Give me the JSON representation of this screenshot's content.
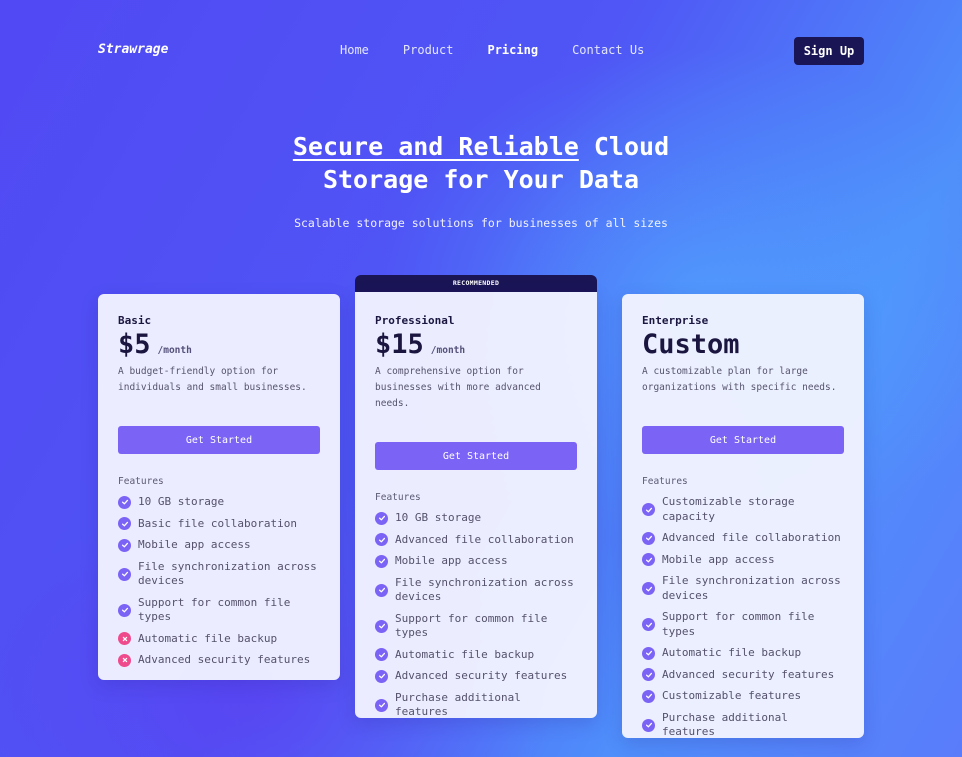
{
  "nav": {
    "brand": "Strawrage",
    "links": [
      "Home",
      "Product",
      "Pricing",
      "Contact Us"
    ],
    "active": "Pricing",
    "signup": "Sign Up"
  },
  "hero": {
    "title_highlight": "Secure and Reliable",
    "title_rest_1": " Cloud",
    "title_rest_2": "Storage for Your Data",
    "subtitle": "Scalable storage solutions for businesses of all sizes"
  },
  "badge": "RECOMMENDED",
  "colors": {
    "accent": "#7b63f6",
    "dark": "#1a1555",
    "no": "#ee4a8c"
  },
  "plans": [
    {
      "name": "Basic",
      "price": "$5",
      "per": "/month",
      "desc": "A budget-friendly option for individuals and small businesses.",
      "cta": "Get Started",
      "features_label": "Features",
      "features": [
        {
          "text": "10 GB storage",
          "ok": true
        },
        {
          "text": "Basic file collaboration",
          "ok": true
        },
        {
          "text": "Mobile app access",
          "ok": true
        },
        {
          "text": "File synchronization across devices",
          "ok": true
        },
        {
          "text": "Support for common file types",
          "ok": true
        },
        {
          "text": "Automatic file backup",
          "ok": false
        },
        {
          "text": "Advanced security features",
          "ok": false
        }
      ]
    },
    {
      "name": "Professional",
      "price": "$15",
      "per": "/month",
      "desc": "A comprehensive option for businesses with more advanced needs.",
      "cta": "Get Started",
      "features_label": "Features",
      "features": [
        {
          "text": "10 GB storage",
          "ok": true
        },
        {
          "text": "Advanced file collaboration",
          "ok": true
        },
        {
          "text": "Mobile app access",
          "ok": true
        },
        {
          "text": "File synchronization across devices",
          "ok": true
        },
        {
          "text": "Support for common file types",
          "ok": true
        },
        {
          "text": "Automatic file backup",
          "ok": true
        },
        {
          "text": "Advanced security features",
          "ok": true
        },
        {
          "text": "Purchase additional features",
          "ok": true
        }
      ]
    },
    {
      "name": "Enterprise",
      "price": "Custom",
      "per": "",
      "desc": "A customizable plan for large organizations with specific needs.",
      "cta": "Get Started",
      "features_label": "Features",
      "features": [
        {
          "text": "Customizable storage capacity",
          "ok": true
        },
        {
          "text": "Advanced file collaboration",
          "ok": true
        },
        {
          "text": "Mobile app access",
          "ok": true
        },
        {
          "text": "File synchronization across devices",
          "ok": true
        },
        {
          "text": "Support for common file types",
          "ok": true
        },
        {
          "text": "Automatic file backup",
          "ok": true
        },
        {
          "text": "Advanced security features",
          "ok": true
        },
        {
          "text": "Customizable features",
          "ok": true
        },
        {
          "text": "Purchase additional features",
          "ok": true
        }
      ]
    }
  ]
}
